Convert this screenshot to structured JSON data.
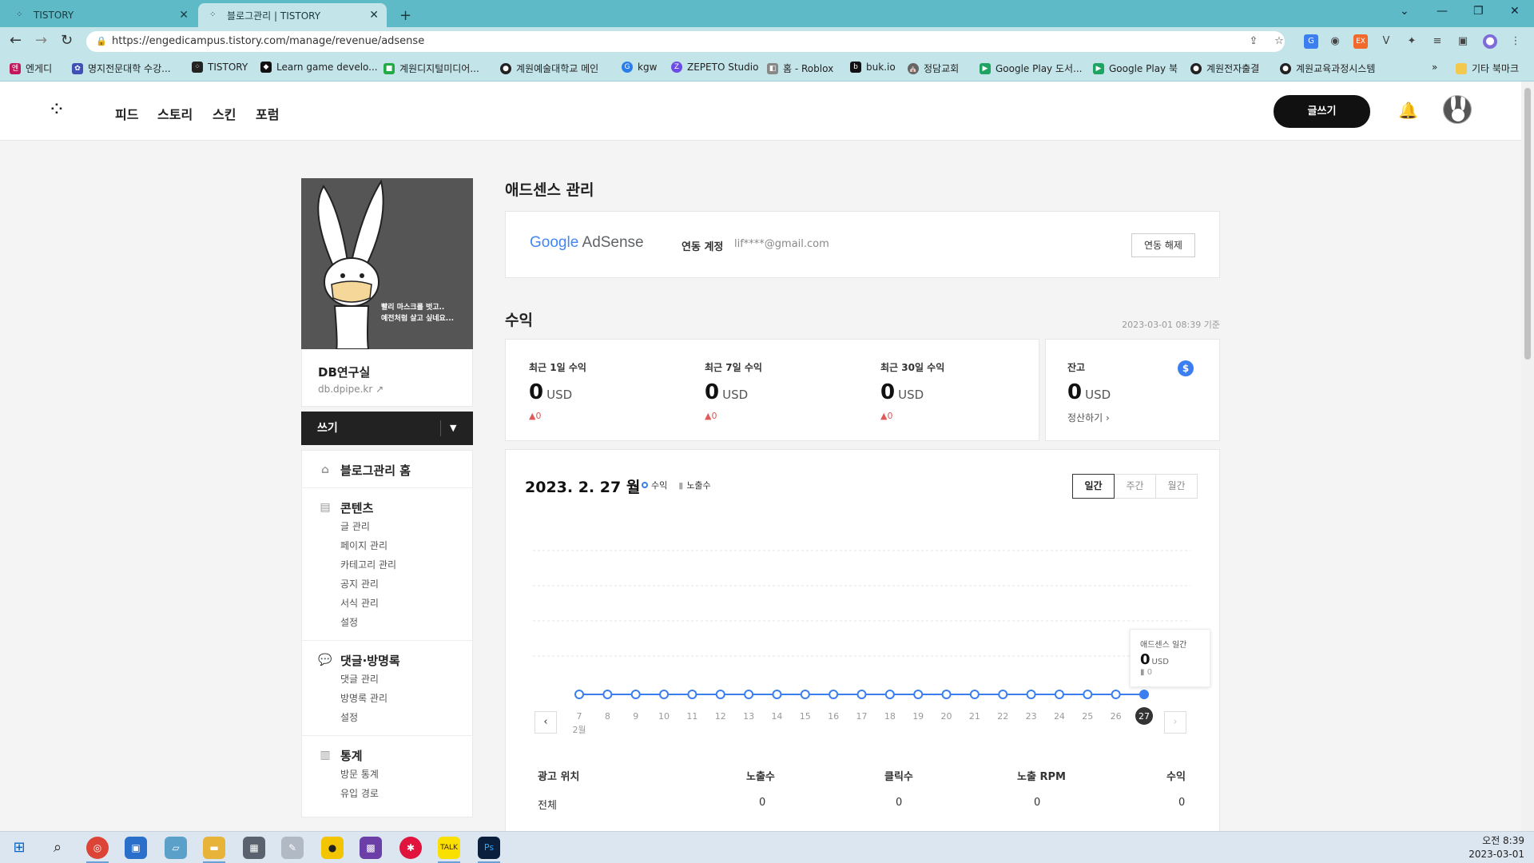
{
  "browser": {
    "tabs": [
      {
        "title": "TISTORY"
      },
      {
        "title": "블로그관리 | TISTORY"
      }
    ],
    "new_tab": "+",
    "url": "https://engedicampus.tistory.com/manage/revenue/adsense",
    "bookmarks": [
      {
        "label": "엔게디",
        "color": "#c2185b"
      },
      {
        "label": "명지전문대학 수강...",
        "color": "#3f51b5"
      },
      {
        "label": "TISTORY",
        "color": "#222222"
      },
      {
        "label": "Learn game develo...",
        "color": "#111111"
      },
      {
        "label": "계원디지털미디어...",
        "color": "#22aa44"
      },
      {
        "label": "계원예술대학교 메인",
        "color": "#222222"
      },
      {
        "label": "kgw",
        "color": "#2b7de9"
      },
      {
        "label": "ZEPETO Studio",
        "color": "#6b4ce6"
      },
      {
        "label": "홈 - Roblox",
        "color": "#888888"
      },
      {
        "label": "buk.io",
        "color": "#111111"
      },
      {
        "label": "정담교회",
        "color": "#666666"
      },
      {
        "label": "Google Play 도서...",
        "color": "#1ea362"
      },
      {
        "label": "Google Play 북",
        "color": "#1ea362"
      },
      {
        "label": "계원전자출결",
        "color": "#222222"
      },
      {
        "label": "계원교육과정시스템",
        "color": "#222222"
      }
    ],
    "bookmarks_more": "»",
    "other_bookmarks": "기타 북마크"
  },
  "header": {
    "nav": [
      "피드",
      "스토리",
      "스킨",
      "포럼"
    ],
    "write_button": "글쓰기"
  },
  "sidebar": {
    "profile_caption_1": "빨리 마스크를 벗고..",
    "profile_caption_2": "예전처럼 살고 싶네요...",
    "blog_name": "DB연구실",
    "blog_url": "db.dpipe.kr",
    "write_label": "쓰기",
    "groups": [
      {
        "title": "블로그관리 홈",
        "items": []
      },
      {
        "title": "콘텐츠",
        "items": [
          "글 관리",
          "페이지 관리",
          "카테고리 관리",
          "공지 관리",
          "서식 관리",
          "설정"
        ]
      },
      {
        "title": "댓글·방명록",
        "items": [
          "댓글 관리",
          "방명록 관리",
          "설정"
        ]
      },
      {
        "title": "통계",
        "items": [
          "방문 통계",
          "유입 경로"
        ]
      }
    ]
  },
  "adsense": {
    "section_title": "애드센스 관리",
    "logo_google": "Google",
    "logo_adsense": "AdSense",
    "linked_account_label": "연동 계정",
    "linked_email": "lif****@gmail.com",
    "unlink_button": "연동 해제"
  },
  "revenue": {
    "section_title": "수익",
    "timestamp": "2023-03-01 08:39 기준",
    "stats": [
      {
        "label": "최근 1일 수익",
        "value": "0",
        "unit": "USD",
        "change": "0"
      },
      {
        "label": "최근 7일 수익",
        "value": "0",
        "unit": "USD",
        "change": "0"
      },
      {
        "label": "최근 30일 수익",
        "value": "0",
        "unit": "USD",
        "change": "0"
      }
    ],
    "balance": {
      "label": "잔고",
      "value": "0",
      "unit": "USD",
      "settle": "정산하기"
    }
  },
  "chart": {
    "date_title": "2023. 2. 27 월",
    "legend_revenue": "수익",
    "legend_impressions": "노출수",
    "period_buttons": [
      "일간",
      "주간",
      "월간"
    ],
    "month_label": "2월",
    "tooltip_title": "애드센스 일간",
    "tooltip_value": "0",
    "tooltip_unit": "USD",
    "tooltip_impressions": "0",
    "accent_color": "#3b7ef0"
  },
  "chart_data": {
    "type": "line",
    "title": "",
    "x": [
      "7",
      "8",
      "9",
      "10",
      "11",
      "12",
      "13",
      "14",
      "15",
      "16",
      "17",
      "18",
      "19",
      "20",
      "21",
      "22",
      "23",
      "24",
      "25",
      "26",
      "27"
    ],
    "series": [
      {
        "name": "수익",
        "values": [
          0,
          0,
          0,
          0,
          0,
          0,
          0,
          0,
          0,
          0,
          0,
          0,
          0,
          0,
          0,
          0,
          0,
          0,
          0,
          0,
          0
        ]
      }
    ],
    "selected": "27",
    "grid": true
  },
  "table": {
    "headers": [
      "광고 위치",
      "노출수",
      "클릭수",
      "노출 RPM",
      "수익"
    ],
    "rows": [
      [
        "전체",
        "0",
        "0",
        "0",
        "0"
      ]
    ]
  },
  "taskbar": {
    "time": "오전 8:39",
    "date": "2023-03-01"
  }
}
